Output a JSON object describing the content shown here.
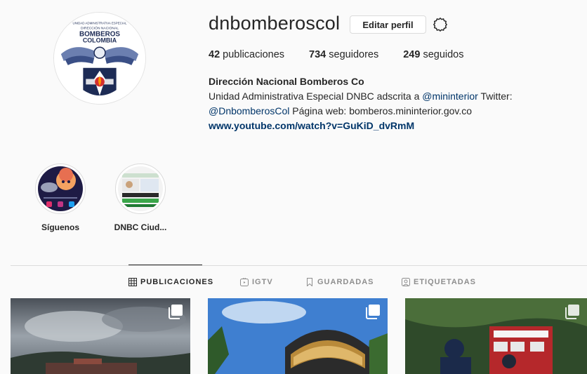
{
  "profile": {
    "username": "dnbomberoscol",
    "edit_button": "Editar perfil",
    "settings_icon": "gear-icon",
    "avatar_text": {
      "line1": "UNIDAD ADMINISTRATIVA ESPECIAL",
      "line2": "DIRECCIÓN NACIONAL",
      "line3": "BOMBEROS",
      "line4": "COLOMBIA"
    },
    "stats": {
      "posts_count": "42",
      "posts_label": "publicaciones",
      "followers_count": "734",
      "followers_label": "seguidores",
      "following_count": "249",
      "following_label": "seguidos"
    },
    "bio": {
      "name": "Dirección Nacional Bomberos Co",
      "text_1": "Unidad Administrativa Especial DNBC adscrita a ",
      "mention_1": "@mininterior",
      "text_2": " Twitter: ",
      "mention_2": "@DnbomberosCol",
      "text_3": " Página web: bomberos.mininterior.gov.co",
      "link": "www.youtube.com/watch?v=GuKiD_dvRmM"
    }
  },
  "highlights": [
    {
      "label": "Síguenos"
    },
    {
      "label": "DNBC Ciud..."
    }
  ],
  "tabs": [
    {
      "label": "PUBLICACIONES",
      "icon": "grid-icon",
      "active": true
    },
    {
      "label": "IGTV",
      "icon": "igtv-icon",
      "active": false
    },
    {
      "label": "GUARDADAS",
      "icon": "bookmark-icon",
      "active": false
    },
    {
      "label": "ETIQUETADAS",
      "icon": "tagged-icon",
      "active": false
    }
  ],
  "posts": [
    {
      "type": "carousel",
      "icon": "multiple-posts-icon"
    },
    {
      "type": "carousel",
      "icon": "multiple-posts-icon"
    },
    {
      "type": "carousel",
      "icon": "multiple-posts-icon"
    }
  ],
  "colors": {
    "background": "#fafafa",
    "text": "#262626",
    "muted": "#8e8e8e",
    "link": "#003569",
    "border": "#dbdbdb"
  }
}
